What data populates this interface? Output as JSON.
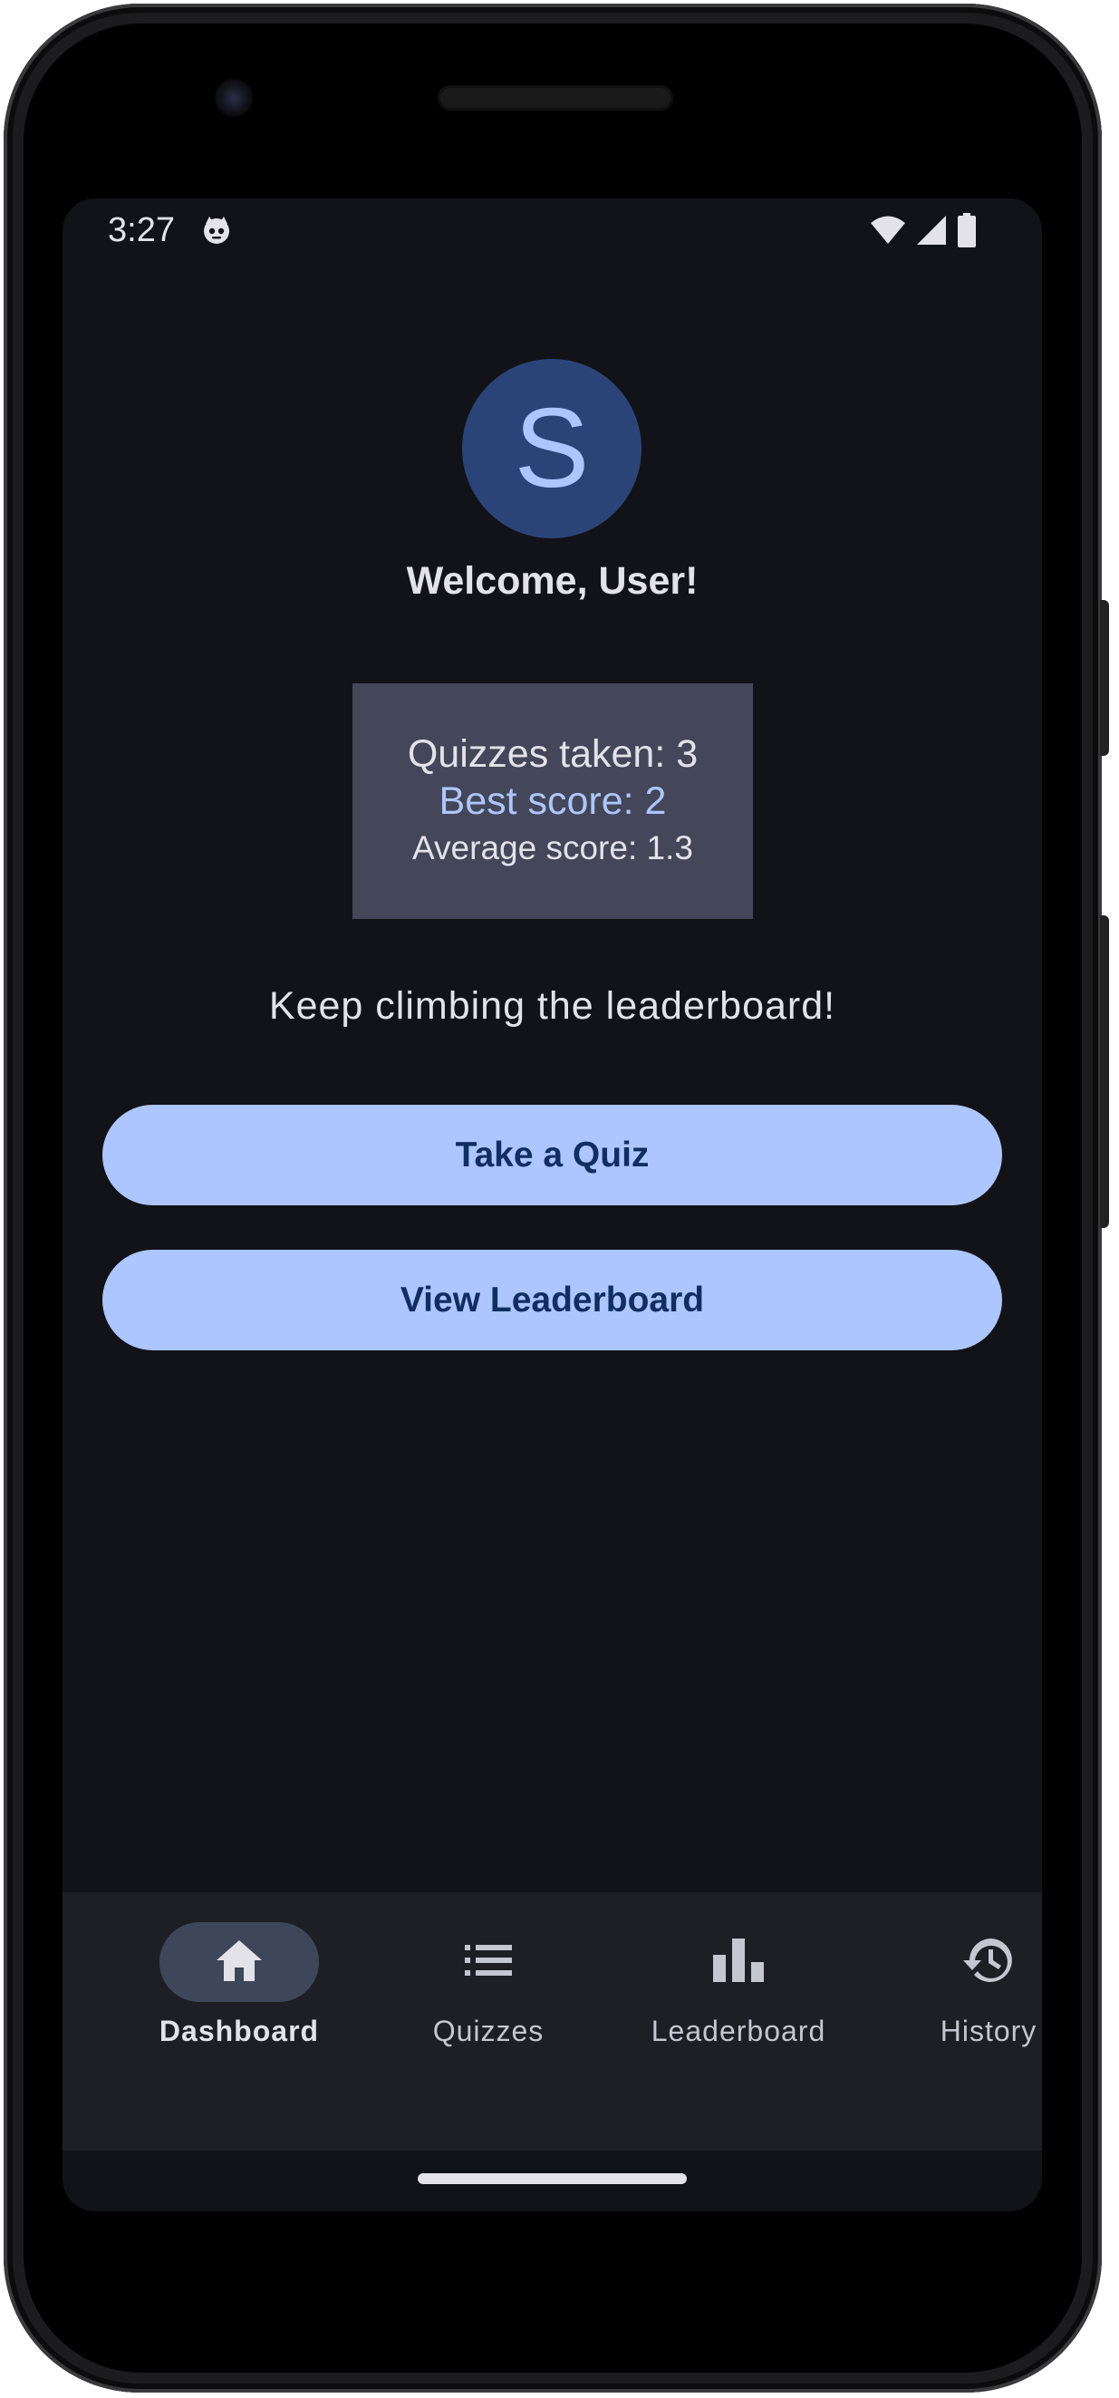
{
  "status_bar": {
    "time": "3:27"
  },
  "profile": {
    "avatar_initial": "S",
    "welcome": "Welcome, User!"
  },
  "stats": {
    "quizzes_taken": "Quizzes taken: 3",
    "best_score": "Best score: 2",
    "average_score": "Average score: 1.3"
  },
  "motivation": "Keep climbing the leaderboard!",
  "actions": {
    "take_quiz": "Take a Quiz",
    "view_leaderboard": "View Leaderboard"
  },
  "bottom_nav": {
    "items": [
      {
        "label": "Dashboard",
        "icon": "home-icon",
        "active": true
      },
      {
        "label": "Quizzes",
        "icon": "list-icon",
        "active": false
      },
      {
        "label": "Leaderboard",
        "icon": "bar-chart-icon",
        "active": false
      },
      {
        "label": "History",
        "icon": "history-icon",
        "active": false
      }
    ]
  },
  "colors": {
    "background": "#121318",
    "accent": "#adc6ff",
    "button_text": "#102f60",
    "card": "#434759",
    "avatar_bg": "#2b4478",
    "nav_bg": "#1e1f25",
    "nav_active_pill": "#3e4759"
  }
}
